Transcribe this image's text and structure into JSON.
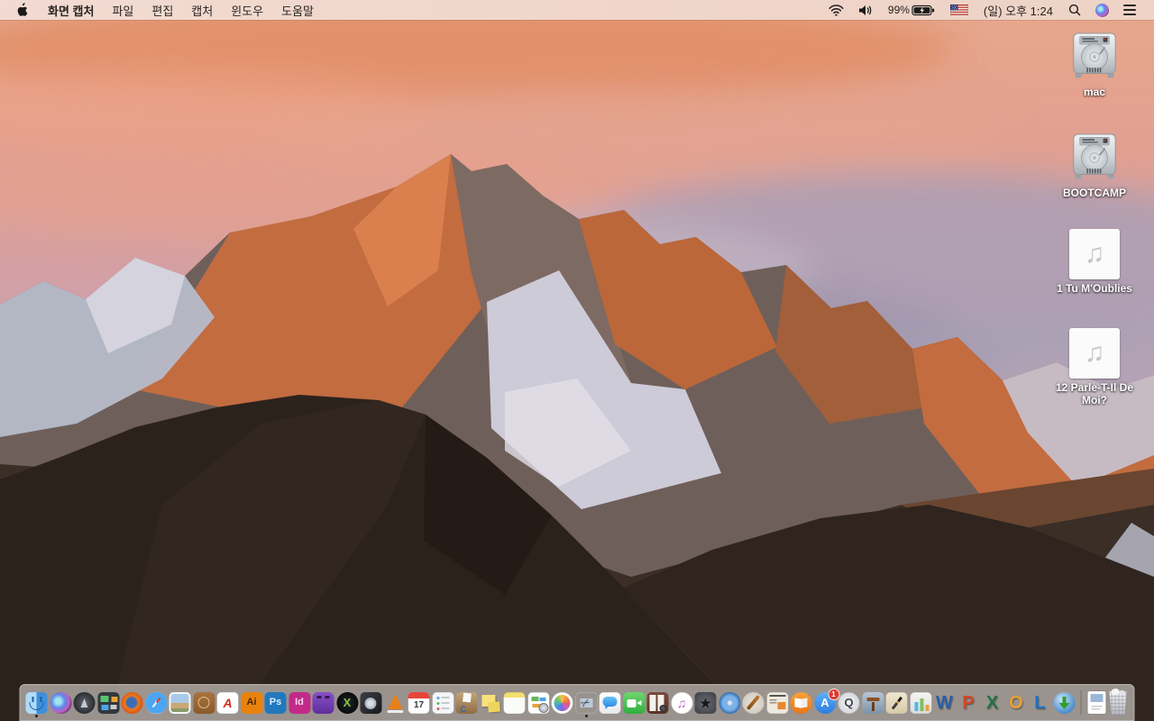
{
  "menu_bar": {
    "menus": [
      {
        "label": "화면 캡처",
        "name": "menu-app-name",
        "bold": true
      },
      {
        "label": "파일",
        "name": "menu-file"
      },
      {
        "label": "편집",
        "name": "menu-edit"
      },
      {
        "label": "캡처",
        "name": "menu-capture"
      },
      {
        "label": "윈도우",
        "name": "menu-window"
      },
      {
        "label": "도움말",
        "name": "menu-help"
      }
    ],
    "status": {
      "battery_percent": "99%",
      "battery_state": "charging",
      "clock": "(일) 오후 1:24",
      "input_source": "us-flag",
      "icons": [
        "wifi",
        "volume",
        "battery-charging",
        "us-flag",
        "spotlight",
        "siri",
        "notification-center"
      ]
    }
  },
  "desktop": {
    "icons": [
      {
        "label": "mac",
        "type": "hard-drive"
      },
      {
        "label": "BOOTCAMP",
        "type": "hard-drive"
      },
      {
        "label": "1 Tu M'Oublies",
        "type": "audio-file",
        "glyph": "♫"
      },
      {
        "label": "12 Parle-T-Il De Moi?",
        "type": "audio-file",
        "glyph": "♫"
      }
    ]
  },
  "dock": {
    "apps": [
      {
        "name": "finder",
        "running": true
      },
      {
        "name": "siri"
      },
      {
        "name": "launchpad"
      },
      {
        "name": "mission-control"
      },
      {
        "name": "firefox"
      },
      {
        "name": "safari"
      },
      {
        "name": "preview"
      },
      {
        "name": "journal"
      },
      {
        "name": "acrobat-reader",
        "glyph": "A"
      },
      {
        "name": "illustrator",
        "glyph": "Ai"
      },
      {
        "name": "photoshop",
        "glyph": "Ps"
      },
      {
        "name": "indesign",
        "glyph": "Id"
      },
      {
        "name": "toast"
      },
      {
        "name": "xbmc",
        "glyph": "X"
      },
      {
        "name": "disk-tool"
      },
      {
        "name": "vlc"
      },
      {
        "name": "calendar",
        "glyph": "17"
      },
      {
        "name": "reminders"
      },
      {
        "name": "drop-box"
      },
      {
        "name": "stickies"
      },
      {
        "name": "notes"
      },
      {
        "name": "web-doc"
      },
      {
        "name": "photos"
      },
      {
        "name": "grab",
        "glyph": "✂",
        "running": true
      },
      {
        "name": "messages"
      },
      {
        "name": "facetime"
      },
      {
        "name": "photo-booth"
      },
      {
        "name": "itunes",
        "glyph": "♫"
      },
      {
        "name": "imovie",
        "glyph": "★"
      },
      {
        "name": "idvd"
      },
      {
        "name": "garageband"
      },
      {
        "name": "newsletter"
      },
      {
        "name": "ibooks"
      },
      {
        "name": "app-store",
        "glyph": "A",
        "badge": "1"
      },
      {
        "name": "quicktime",
        "glyph": "Q"
      },
      {
        "name": "keynote"
      },
      {
        "name": "pages"
      },
      {
        "name": "numbers"
      },
      {
        "name": "word",
        "glyph": "W"
      },
      {
        "name": "powerpoint",
        "glyph": "P"
      },
      {
        "name": "excel",
        "glyph": "X"
      },
      {
        "name": "outlook",
        "glyph": "O"
      },
      {
        "name": "lync",
        "glyph": "L"
      },
      {
        "name": "downloader"
      }
    ],
    "files": [
      {
        "name": "document"
      }
    ],
    "trash": {
      "name": "trash",
      "state": "full"
    }
  },
  "colors": {
    "menu_bar_bg": "#eed8cd",
    "dock_bg": "rgba(233,227,224,0.58)",
    "sky_top": "#e7a78c",
    "sky_bottom": "#c3b8c8",
    "rock_lit": "#c26c40",
    "rock_shadow": "#6f5f5a",
    "snow": "#cecbd8",
    "foreground_rock": "#2c221c",
    "badge_red": "#e0382e"
  }
}
